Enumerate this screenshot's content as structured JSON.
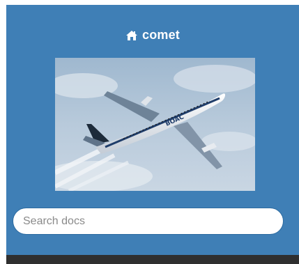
{
  "project": {
    "name": "comet",
    "home_icon": "home-icon"
  },
  "logo": {
    "image": "airplane-logo",
    "livery": "BOAC"
  },
  "search": {
    "placeholder": "Search docs",
    "value": ""
  },
  "colors": {
    "sidebar_bg": "#3f7fb6",
    "footer_bar": "#2f2f2f",
    "text": "#ffffff"
  }
}
